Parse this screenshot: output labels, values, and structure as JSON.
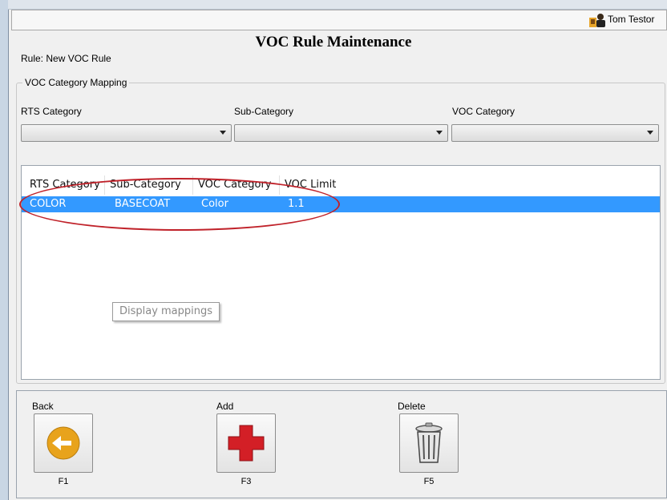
{
  "user": {
    "name": "Tom Testor"
  },
  "page": {
    "title": "VOC Rule Maintenance",
    "rule_line": "Rule:  New VOC Rule"
  },
  "group": {
    "title": "VOC Category Mapping"
  },
  "filters": {
    "rts_label": "RTS Category",
    "sub_label": "Sub-Category",
    "voc_label": "VOC Category",
    "rts_value": "",
    "sub_value": "",
    "voc_value": ""
  },
  "grid": {
    "headers": [
      "RTS Category",
      "Sub-Category",
      "VOC Category",
      "VOC Limit"
    ],
    "rows": [
      [
        "COLOR",
        "BASECOAT",
        "Color",
        "1.1"
      ]
    ]
  },
  "tooltip": "Display mappings",
  "buttons": {
    "back": {
      "label": "Back",
      "key": "F1"
    },
    "add": {
      "label": "Add",
      "key": "F3"
    },
    "delete": {
      "label": "Delete",
      "key": "F5"
    }
  },
  "colors": {
    "selection": "#3399ff",
    "annotation": "#c0222a",
    "back_icon": "#e8a31c",
    "add_icon": "#d31f26"
  }
}
